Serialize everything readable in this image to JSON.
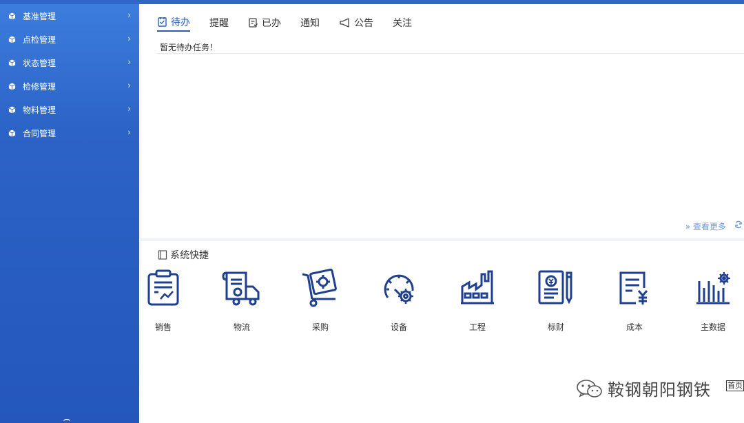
{
  "sidebar": {
    "items": [
      {
        "label": "基准管理",
        "icon": "cube-icon"
      },
      {
        "label": "点检管理",
        "icon": "cube-icon"
      },
      {
        "label": "状态管理",
        "icon": "cube-icon"
      },
      {
        "label": "检修管理",
        "icon": "cube-icon"
      },
      {
        "label": "物料管理",
        "icon": "cube-icon"
      },
      {
        "label": "合同管理",
        "icon": "cube-icon"
      }
    ],
    "chevron": "›"
  },
  "tasks": {
    "tabs": [
      {
        "label": "待办",
        "icon": "todo-icon",
        "active": true
      },
      {
        "label": "提醒",
        "icon": "",
        "active": false
      },
      {
        "label": "已办",
        "icon": "done-icon",
        "active": false
      },
      {
        "label": "通知",
        "icon": "",
        "active": false
      },
      {
        "label": "公告",
        "icon": "megaphone-icon",
        "active": false
      },
      {
        "label": "关注",
        "icon": "",
        "active": false
      }
    ],
    "empty_message": "暂无待办任务！",
    "more_label": "» 查看更多"
  },
  "shortcuts": {
    "title": "系统快捷",
    "items": [
      {
        "label": "销售",
        "icon": "sales-icon"
      },
      {
        "label": "物流",
        "icon": "logistics-icon"
      },
      {
        "label": "采购",
        "icon": "purchase-icon"
      },
      {
        "label": "设备",
        "icon": "equipment-icon"
      },
      {
        "label": "工程",
        "icon": "engineering-icon"
      },
      {
        "label": "标财",
        "icon": "finance-icon"
      },
      {
        "label": "成本",
        "icon": "cost-icon"
      },
      {
        "label": "主数据",
        "icon": "master-data-icon"
      }
    ]
  },
  "watermark": {
    "text": "鞍钢朝阳钢铁",
    "icon": "wechat-icon"
  },
  "home_badge": "首页",
  "colors": {
    "sidebar": "#2c63c6",
    "accent": "#2a5db5",
    "icon_blue": "#1f3f8f"
  }
}
